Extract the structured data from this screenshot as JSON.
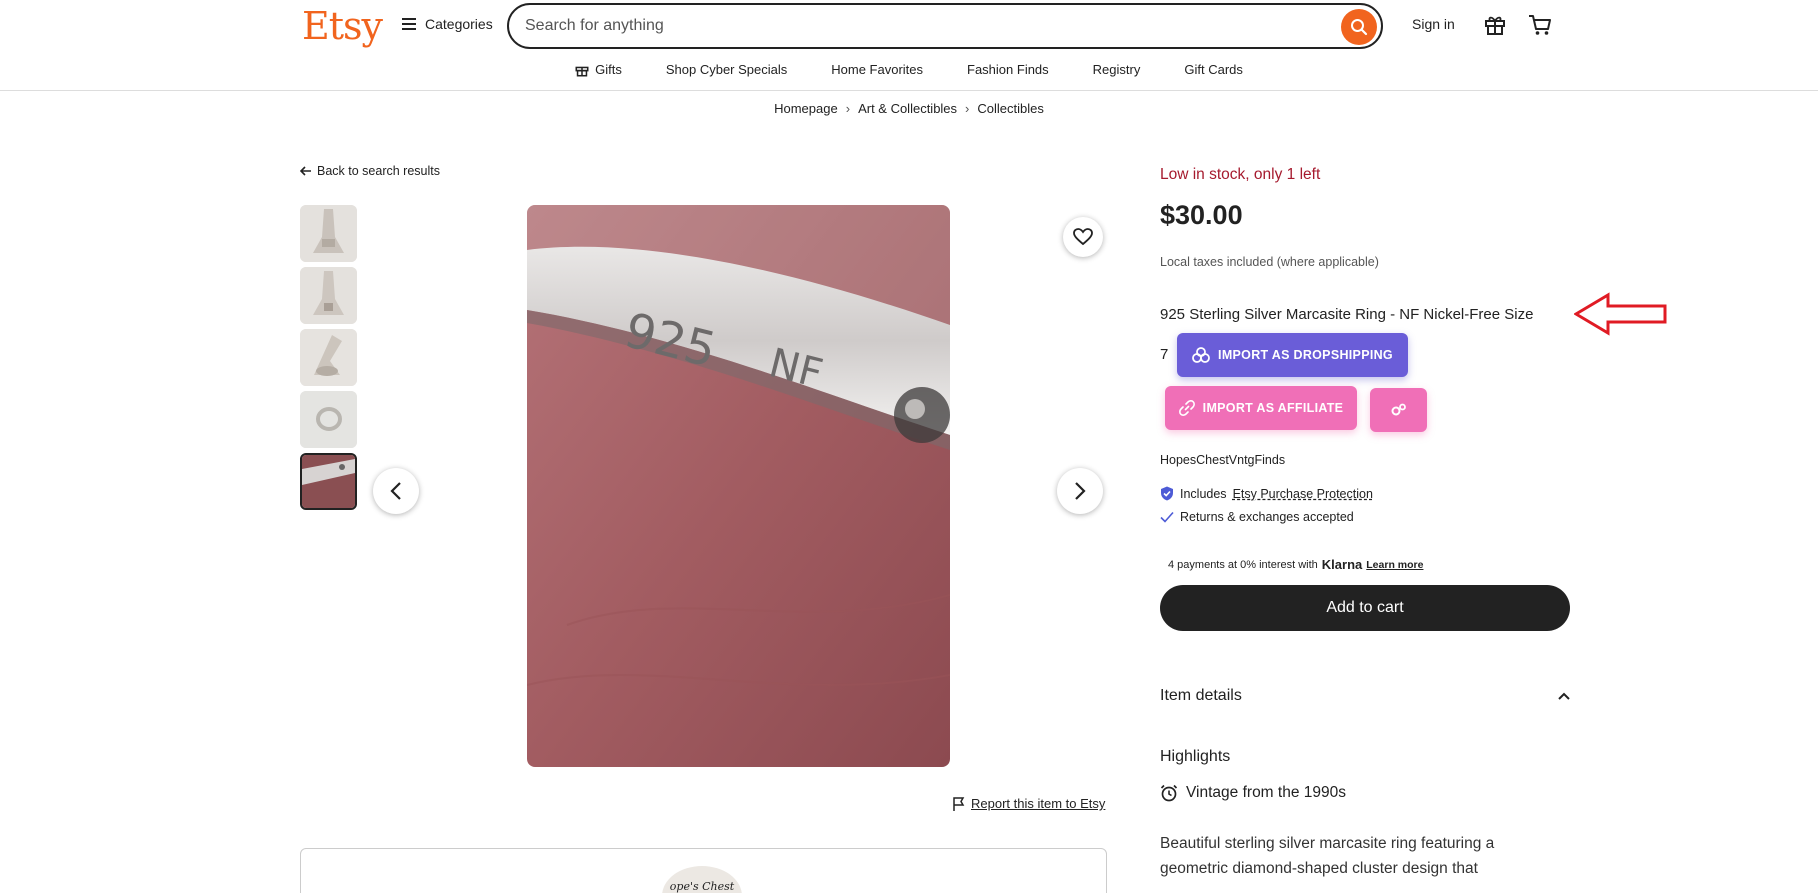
{
  "header": {
    "logo": "Etsy",
    "categories_label": "Categories",
    "search_placeholder": "Search for anything",
    "signin_label": "Sign in"
  },
  "nav": {
    "items": [
      "Gifts",
      "Shop Cyber Specials",
      "Home Favorites",
      "Fashion Finds",
      "Registry",
      "Gift Cards"
    ]
  },
  "breadcrumb": [
    "Homepage",
    "Art & Collectibles",
    "Collectibles"
  ],
  "gallery": {
    "back_label": "Back to search results",
    "thumbnail_count": 5,
    "selected_thumbnail": 5,
    "report_label": "Report this item to Etsy",
    "shop_logo_text": "ope's Chest"
  },
  "product": {
    "stock": "Low in stock, only 1 left",
    "price": "$30.00",
    "tax_note": "Local taxes included (where applicable)",
    "title_line1": "925 Sterling Silver Marcasite Ring - NF Nickel-Free Size",
    "title_line2": "7",
    "shop_name": "HopesChestVntgFinds",
    "protection_prefix": "Includes",
    "protection_link": "Etsy Purchase Protection",
    "returns": "Returns & exchanges accepted",
    "klarna_text": "4 payments at 0% interest with",
    "klarna_brand": "Klarna",
    "klarna_learn": "Learn more",
    "add_to_cart": "Add to cart",
    "item_details": "Item details",
    "highlights": "Highlights",
    "vintage": "Vintage from the 1990s",
    "description": "Beautiful sterling silver marcasite ring featuring a geometric diamond-shaped cluster design that"
  },
  "extension": {
    "dropship_label": "IMPORT AS DROPSHIPPING",
    "affiliate_label": "IMPORT AS AFFILIATE"
  },
  "colors": {
    "brand": "#F1641E",
    "stock_red": "#A61A2E",
    "dropship_purple": "#6a5dd8",
    "affiliate_pink": "#f06fb7",
    "annotation_arrow": "#e01b24"
  }
}
